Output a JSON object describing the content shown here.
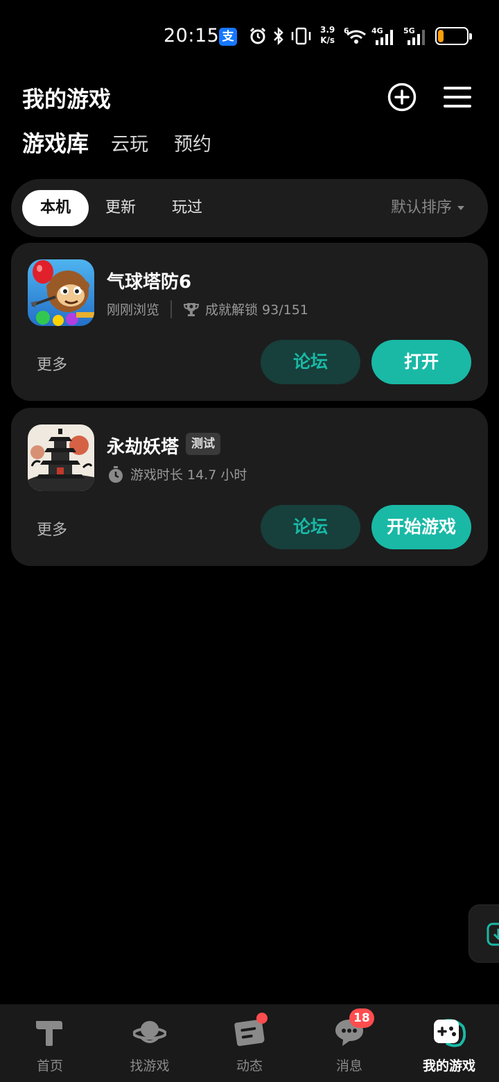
{
  "status_bar": {
    "time": "20:15",
    "alipay_label": "支",
    "net_speed_value": "3.9",
    "net_speed_unit": "K/s",
    "battery": "11",
    "battery_level": 0.11,
    "battery_color": "#ff9f0a",
    "wifi_label": "6",
    "sim1_label": "4G",
    "sim2_label": "5G"
  },
  "header": {
    "title": "我的游戏",
    "add_icon": "plus-circle-icon",
    "menu_icon": "hamburger-menu-icon"
  },
  "tabs": [
    {
      "label": "游戏库",
      "active": true
    },
    {
      "label": "云玩",
      "active": false
    },
    {
      "label": "预约",
      "active": false
    }
  ],
  "filters": {
    "chips": [
      "本机",
      "更新",
      "玩过"
    ],
    "active": "本机",
    "sort_label": "默认排序"
  },
  "games": [
    {
      "name": "气球塔防6",
      "meta_left": "刚刚浏览",
      "meta_right": "成就解锁 93/151",
      "more_label": "更多",
      "forum_label": "论坛",
      "primary_label": "打开"
    },
    {
      "name": "永劫妖塔",
      "tag": "测试",
      "meta": "游戏时长 14.7 小时",
      "more_label": "更多",
      "forum_label": "论坛",
      "primary_label": "开始游戏"
    }
  ],
  "bottom_nav": [
    {
      "label": "首页",
      "icon": "home-hammer-icon"
    },
    {
      "label": "找游戏",
      "icon": "planet-icon"
    },
    {
      "label": "动态",
      "icon": "feed-icon",
      "dot": true
    },
    {
      "label": "消息",
      "icon": "chat-bubble-icon",
      "badge": "18"
    },
    {
      "label": "我的游戏",
      "icon": "gamepad-icon",
      "active": true
    }
  ],
  "colors": {
    "accent": "#19b9a6",
    "card_bg": "#1d1d1d",
    "forum_bg": "#173f3b",
    "badge": "#ff4d4f"
  }
}
